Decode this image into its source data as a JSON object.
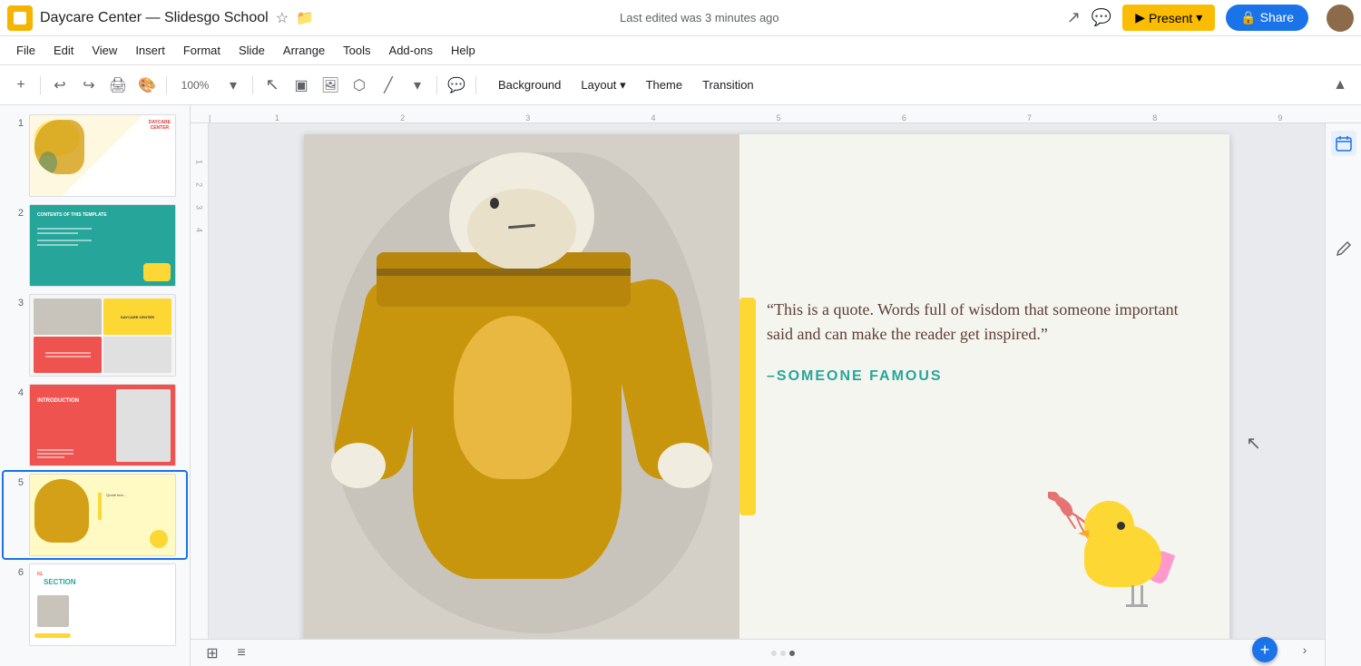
{
  "app": {
    "icon": "G",
    "title": "Daycare Center — Slidesgo School",
    "last_edit": "Last edited was 3 minutes ago"
  },
  "title_bar": {
    "star_icon": "☆",
    "folder_icon": "📁",
    "present_label": "Present",
    "share_label": "🔒 Share"
  },
  "menu": {
    "items": [
      "File",
      "Edit",
      "View",
      "Insert",
      "Format",
      "Slide",
      "Arrange",
      "Tools",
      "Add-ons",
      "Help"
    ]
  },
  "toolbar": {
    "add_btn": "+",
    "undo": "↩",
    "redo": "↪",
    "print": "🖨",
    "paint": "🎨",
    "zoom": "100%",
    "select_arrow": "↖",
    "frame_tool": "▣",
    "image_tool": "🖼",
    "shape_tool": "⬡",
    "line_tool": "╱",
    "more_tool": "⋮",
    "comment_btn": "+",
    "background_label": "Background",
    "layout_label": "Layout",
    "layout_arrow": "▾",
    "theme_label": "Theme",
    "transition_label": "Transition",
    "collapse_btn": "▲"
  },
  "slides": [
    {
      "number": 1,
      "type": "title",
      "active": false
    },
    {
      "number": 2,
      "type": "teal",
      "active": false
    },
    {
      "number": 3,
      "type": "grid",
      "active": false
    },
    {
      "number": 4,
      "type": "red",
      "active": false
    },
    {
      "number": 5,
      "type": "quote",
      "active": true
    },
    {
      "number": 6,
      "type": "section",
      "active": false
    }
  ],
  "slide5": {
    "quote_text": "“This is a quote. Words full of wisdom that someone important said and can make the reader get inspired.”",
    "quote_author": "–SOMEONE FAMOUS"
  },
  "ruler": {
    "marks": [
      "1",
      "2",
      "3",
      "4",
      "5",
      "6",
      "7",
      "8",
      "9"
    ]
  },
  "right_sidebar": {
    "icons": [
      "calendar",
      "chat",
      "pencil"
    ]
  },
  "bottom_bar": {
    "view_grid_label": "⊞",
    "view_list_label": "≡",
    "add_slide_label": "+",
    "expand_label": "›"
  }
}
